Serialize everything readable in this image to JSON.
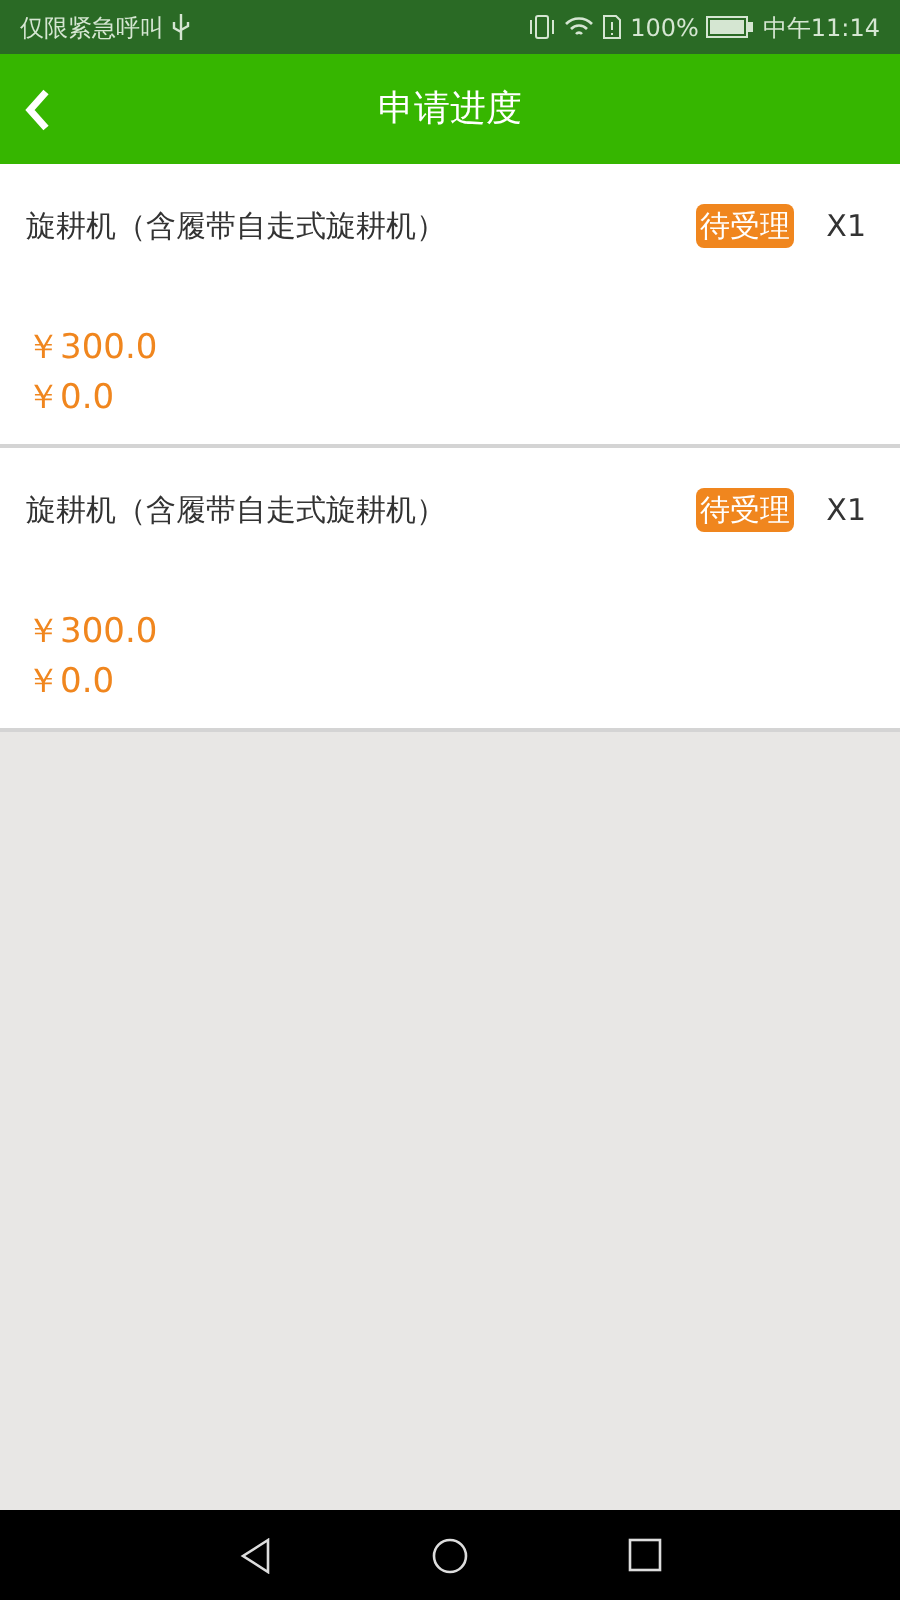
{
  "status_bar": {
    "carrier": "仅限紧急呼叫",
    "battery": "100%",
    "time": "中午11:14"
  },
  "header": {
    "title": "申请进度"
  },
  "applications": [
    {
      "name": "旋耕机（含履带自走式旋耕机）",
      "status": "待受理",
      "quantity": "X1",
      "price": "￥300.0",
      "subsidy": "￥0.0"
    },
    {
      "name": "旋耕机（含履带自走式旋耕机）",
      "status": "待受理",
      "quantity": "X1",
      "price": "￥300.0",
      "subsidy": "￥0.0"
    }
  ]
}
